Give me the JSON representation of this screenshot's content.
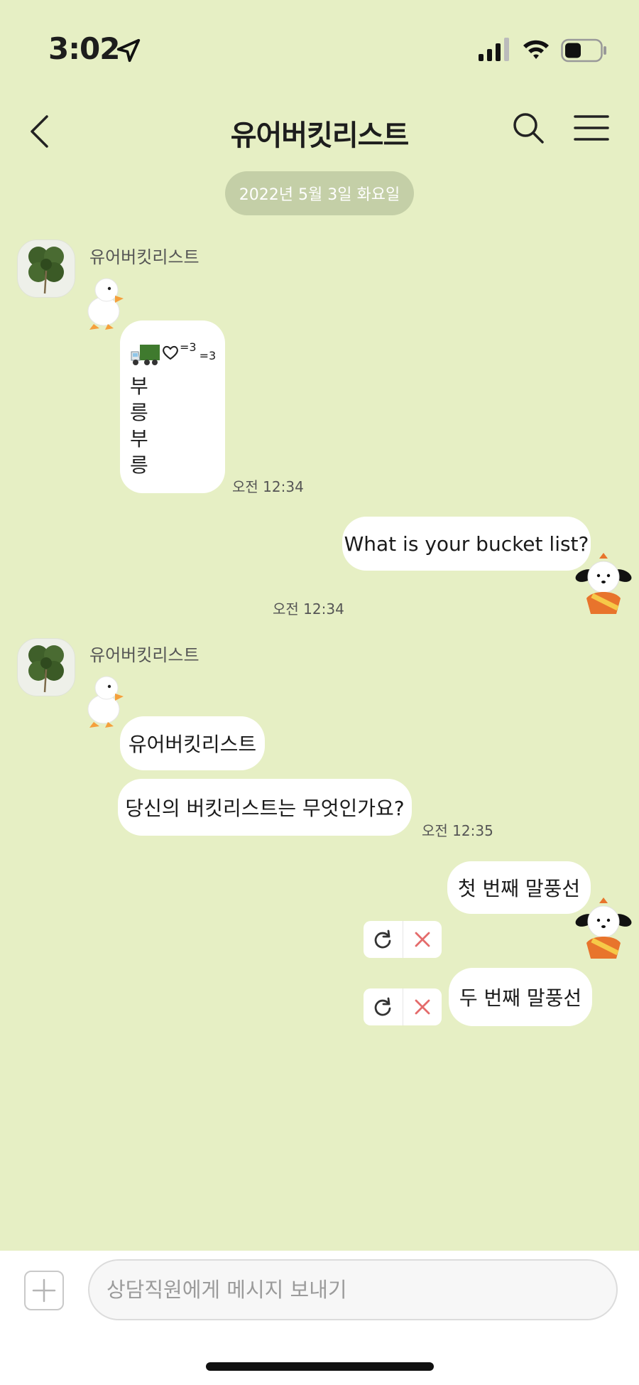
{
  "status_bar": {
    "time": "3:02"
  },
  "nav": {
    "title": "유어버킷리스트"
  },
  "date_divider": "2022년 5월 3일 화요일",
  "messages": {
    "group1": {
      "sender": "유어버킷리스트",
      "sup1": "=3",
      "sup2": "=3",
      "vertical_chars": [
        "부",
        "릉",
        "부",
        "릉"
      ],
      "time": "오전 12:34"
    },
    "outgoing1": {
      "text": "What is your bucket list?",
      "time": "오전 12:34"
    },
    "group2": {
      "sender": "유어버킷리스트",
      "bubble1": "유어버킷리스트",
      "bubble2": "당신의 버킷리스트는 무엇인가요?",
      "time": "오전 12:35"
    },
    "outgoing2": {
      "bubble1": "첫 번째 말풍선",
      "bubble2": "두 번째 말풍선"
    }
  },
  "composer": {
    "placeholder": "상담직원에게 메시지 보내기"
  },
  "icons": {
    "truck": "truck-emoji",
    "heart": "heart-outline",
    "retry": "retry-icon",
    "delete": "x-icon",
    "avatar": "clover-icon",
    "duck": "duck-sticker",
    "dog": "dog-sticker"
  },
  "colors": {
    "background": "#e6efc4",
    "bubble": "#ffffff",
    "date_pill": "#c4cfa7",
    "delete_x": "#e46b6b"
  }
}
